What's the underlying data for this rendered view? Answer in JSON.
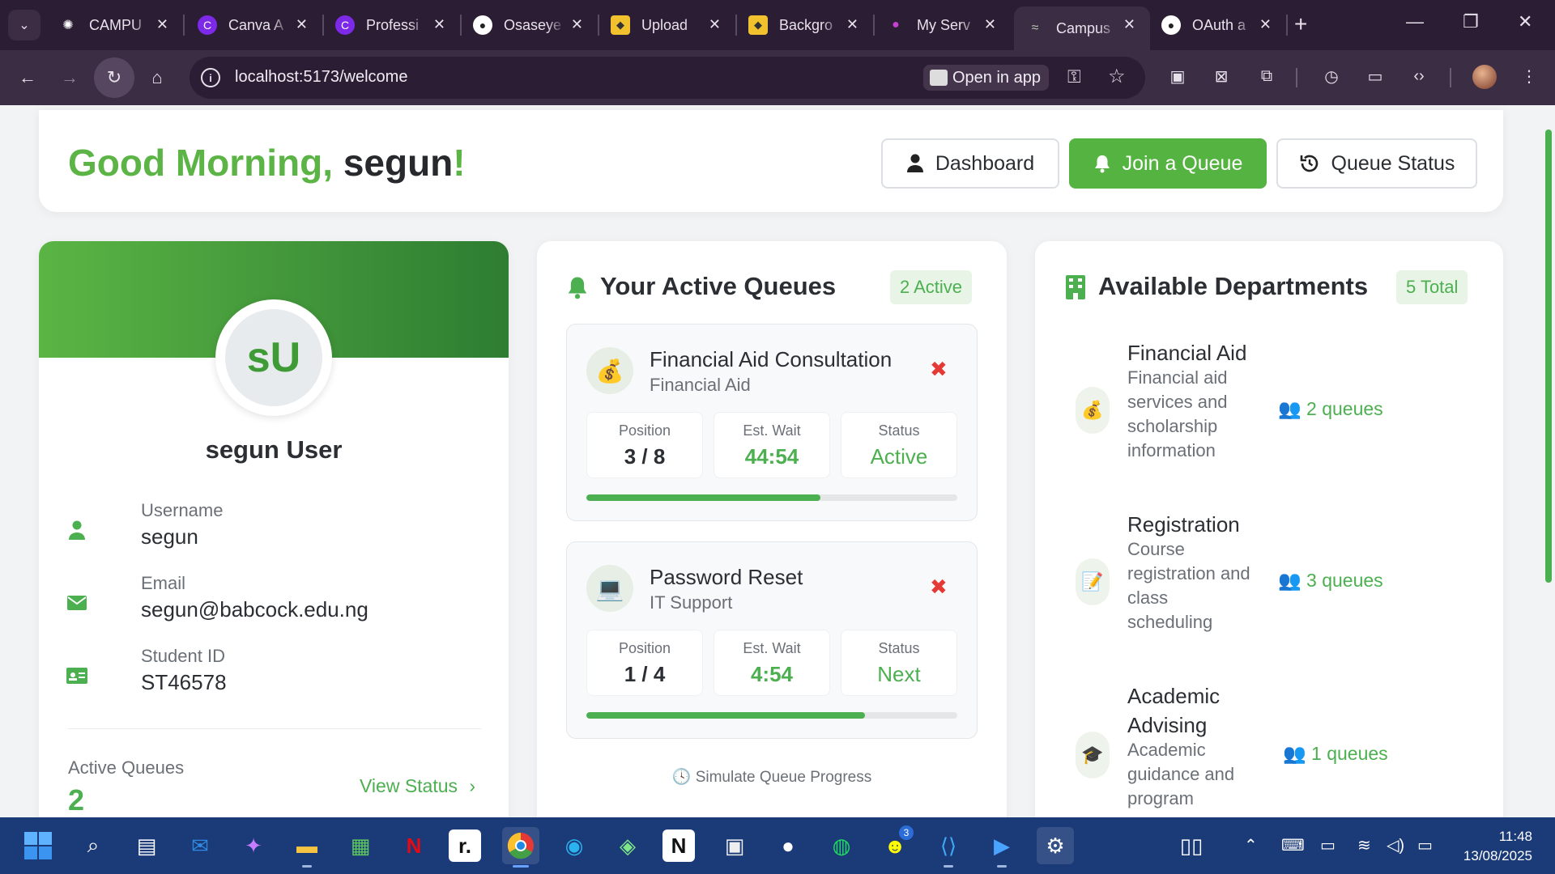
{
  "browser": {
    "tabs": [
      {
        "label": "CAMPU",
        "icon": "openai-icon"
      },
      {
        "label": "Canva A",
        "icon": "canva-icon"
      },
      {
        "label": "Professi",
        "icon": "canva-icon"
      },
      {
        "label": "Osaseye",
        "icon": "github-icon"
      },
      {
        "label": "Upload",
        "icon": "layers-icon"
      },
      {
        "label": "Backgro",
        "icon": "layers-icon"
      },
      {
        "label": "My Serv",
        "icon": "app-icon"
      },
      {
        "label": "Campus",
        "icon": "queue-icon"
      },
      {
        "label": "OAuth a",
        "icon": "github-icon"
      }
    ],
    "active_tab_index": 7,
    "url": "localhost:5173/welcome",
    "open_in_app": "Open in app"
  },
  "header": {
    "greeting": "Good Morning,",
    "username": "segun",
    "exclaim": "!",
    "buttons": {
      "dashboard": "Dashboard",
      "join": "Join a Queue",
      "status": "Queue Status"
    }
  },
  "profile": {
    "initials": "sU",
    "full_name": "segun User",
    "fields": [
      {
        "label": "Username",
        "value": "segun",
        "icon": "user-icon"
      },
      {
        "label": "Email",
        "value": "segun@babcock.edu.ng",
        "icon": "envelope-icon"
      },
      {
        "label": "Student ID",
        "value": "ST46578",
        "icon": "id-card-icon"
      }
    ],
    "active_queues_label": "Active Queues",
    "active_queues_count": "2",
    "view_status": "View Status"
  },
  "queues": {
    "title": "Your Active Queues",
    "badge": "2 Active",
    "items": [
      {
        "title": "Financial Aid Consultation",
        "department": "Financial Aid",
        "emoji": "💰",
        "position_label": "Position",
        "position": "3 / 8",
        "wait_label": "Est. Wait",
        "wait": "44:54",
        "status_label": "Status",
        "status": "Active",
        "progress": 0.63
      },
      {
        "title": "Password Reset",
        "department": "IT Support",
        "emoji": "💻",
        "position_label": "Position",
        "position": "1 / 4",
        "wait_label": "Est. Wait",
        "wait": "4:54",
        "status_label": "Status",
        "status": "Next",
        "progress": 0.75
      }
    ],
    "simulate": "Simulate Queue Progress"
  },
  "departments": {
    "title": "Available Departments",
    "badge": "5 Total",
    "items": [
      {
        "name": "Financial Aid",
        "desc": "Financial aid services and scholarship information",
        "queues": "2 queues",
        "emoji": "💰"
      },
      {
        "name": "Registration",
        "desc": "Course registration and class scheduling",
        "queues": "3 queues",
        "emoji": "📝"
      },
      {
        "name": "Academic Advising",
        "desc": "Academic guidance and program",
        "queues": "1 queues",
        "emoji": "🎓"
      }
    ]
  },
  "taskbar": {
    "time": "11:48",
    "date": "13/08/2025",
    "notification_count": "3"
  },
  "colors": {
    "accent": "#4caf50",
    "danger": "#e53935",
    "chrome": "#2b1d33",
    "taskbar": "#1b3a78"
  }
}
